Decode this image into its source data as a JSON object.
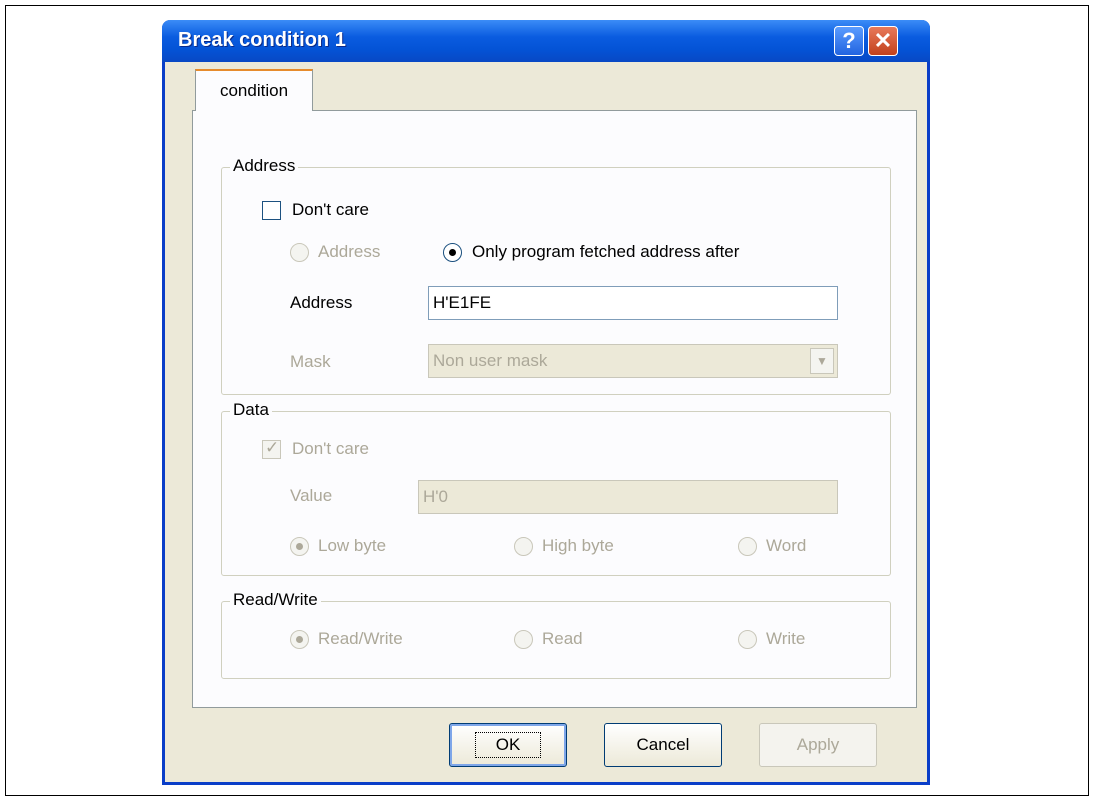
{
  "window": {
    "title": "Break condition 1"
  },
  "titlebar": {
    "help": "?",
    "close": "✕"
  },
  "tabs": [
    {
      "label": "condition"
    }
  ],
  "address": {
    "group_label": "Address",
    "dont_care_label": "Don't care",
    "dont_care_checked": false,
    "radio_address_label": "Address",
    "radio_only_program_label": "Only program fetched address after",
    "selected": "Only program fetched address after",
    "address_label": "Address",
    "address_value": "H'E1FE",
    "mask_label": "Mask",
    "mask_value": "Non user mask"
  },
  "data": {
    "group_label": "Data",
    "dont_care_label": "Don't care",
    "dont_care_checked": true,
    "value_label": "Value",
    "value": "H'0",
    "low_byte": "Low byte",
    "high_byte": "High byte",
    "word": "Word",
    "selected": "Low byte"
  },
  "readwrite": {
    "group_label": "Read/Write",
    "read_write": "Read/Write",
    "read": "Read",
    "write": "Write",
    "selected": "Read/Write"
  },
  "buttons": {
    "ok": "OK",
    "cancel": "Cancel",
    "apply": "Apply"
  }
}
